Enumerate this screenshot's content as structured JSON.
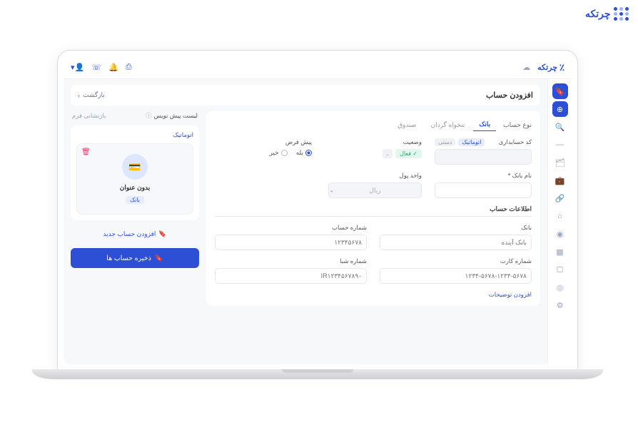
{
  "brand": {
    "name": "چرتکه"
  },
  "topbar": {
    "logo": "چرتکه"
  },
  "page": {
    "title": "افزودن حساب",
    "back": "بازگشت"
  },
  "accountType": {
    "label": "نوع حساب",
    "tabs": {
      "bank": "بانک",
      "tankhah": "تنخواه گردان",
      "sandogh": "صندوق"
    }
  },
  "fields": {
    "code": {
      "label": "کد حسابداری",
      "tag_auto": "اتوماتیک",
      "tag_manual": "دستی"
    },
    "status": {
      "label": "وضعیت",
      "active": "فعال",
      "inactive": "ـ"
    },
    "default": {
      "label": "پیش فرض",
      "yes": "بله",
      "no": "خیر"
    },
    "bankName": {
      "label": "نام بانک"
    },
    "currency": {
      "label": "واحد پول",
      "value": "ریال"
    },
    "section": "اطلاعات حساب",
    "bank": {
      "label": "بانک",
      "placeholder": "بانک آینده"
    },
    "accountNo": {
      "label": "شماره حساب",
      "placeholder": "۱۲۳۴۵۶۷۸"
    },
    "cardNo": {
      "label": "شماره کارت",
      "placeholder": "۱۲۳۴-۵۶۷۸-۱۲۳۴-۵۶۷۸"
    },
    "sheba": {
      "label": "شماره شبا",
      "placeholder": "IR۱۲۳۴۵۶۷۸۹۰"
    },
    "addDesc": "افزودن توضیحات"
  },
  "preview": {
    "listTitle": "لیست پیش نویس",
    "reset": "بازنشانی فرم",
    "auto": "اتوماتیک",
    "cardTitle": "بدون عنوان",
    "cardTag": "بانک",
    "addNew": "افزودن حساب جدید",
    "save": "ذخیره حساب ها"
  }
}
